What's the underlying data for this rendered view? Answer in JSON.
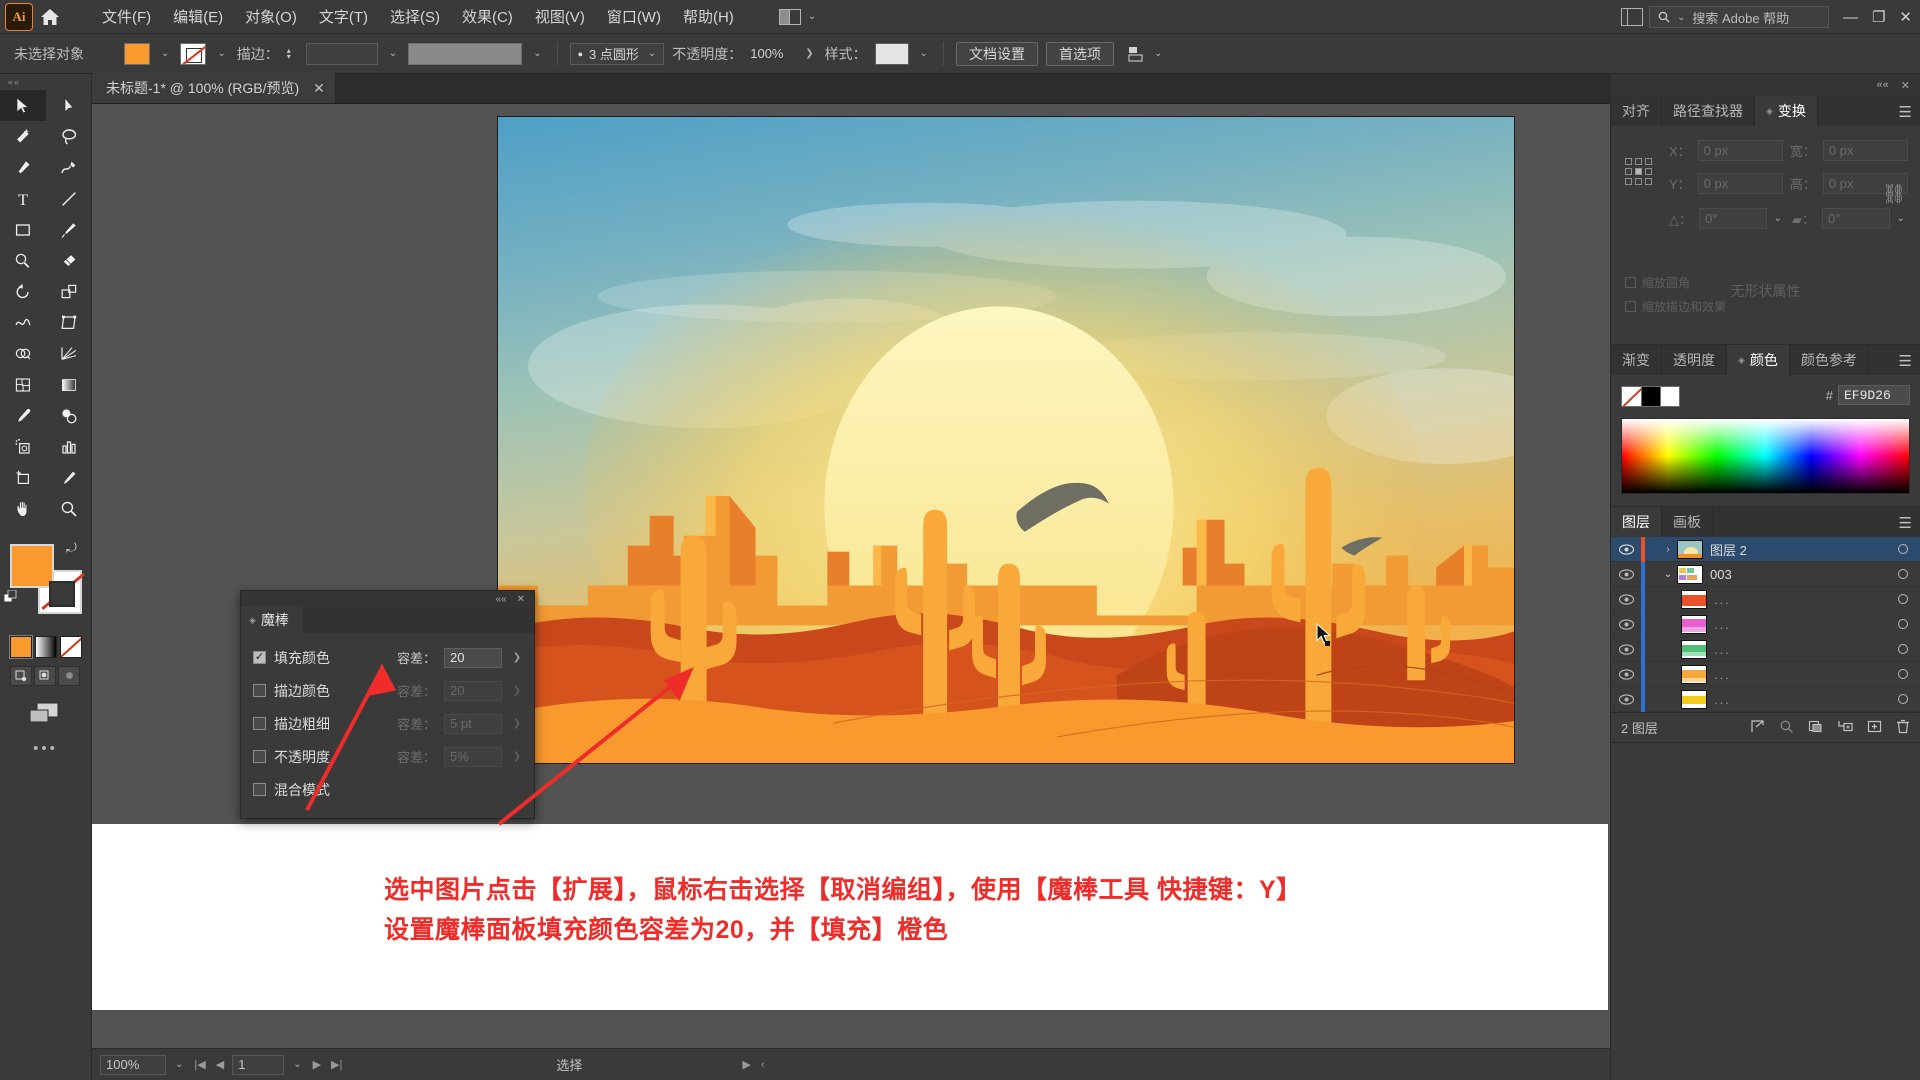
{
  "app": {
    "name": "Adobe Illustrator",
    "logo_text": "Ai"
  },
  "menubar": {
    "items": [
      {
        "label": "文件(F)"
      },
      {
        "label": "编辑(E)"
      },
      {
        "label": "对象(O)"
      },
      {
        "label": "文字(T)"
      },
      {
        "label": "选择(S)"
      },
      {
        "label": "效果(C)"
      },
      {
        "label": "视图(V)"
      },
      {
        "label": "窗口(W)"
      },
      {
        "label": "帮助(H)"
      }
    ],
    "search_placeholder": "搜索 Adobe 帮助",
    "minimize": "—",
    "restore": "❐",
    "close": "✕"
  },
  "controlbar": {
    "selection_status": "未选择对象",
    "fill_color": "#F89A2E",
    "stroke_label": "描边：",
    "stroke_weight": "",
    "stroke_profile": "",
    "brush_def": "3 点圆形",
    "opacity_label": "不透明度：",
    "opacity_value": "100%",
    "style_label": "样式：",
    "doc_setup_button": "文档设置",
    "preferences_button": "首选项",
    "align_label": ""
  },
  "document_tab": {
    "title": "未标题-1* @ 100% (RGB/预览)",
    "close": "✕"
  },
  "toolbar": {
    "tools": [
      {
        "name": "selection-tool",
        "selected": true
      },
      {
        "name": "direct-selection-tool",
        "selected": false
      },
      {
        "name": "magic-wand-tool",
        "selected": false
      },
      {
        "name": "lasso-tool",
        "selected": false
      },
      {
        "name": "pen-tool",
        "selected": false
      },
      {
        "name": "curvature-tool",
        "selected": false
      },
      {
        "name": "type-tool",
        "selected": false
      },
      {
        "name": "line-segment-tool",
        "selected": false
      },
      {
        "name": "rectangle-tool",
        "selected": false
      },
      {
        "name": "paintbrush-tool",
        "selected": false
      },
      {
        "name": "shaper-tool",
        "selected": false
      },
      {
        "name": "eraser-tool",
        "selected": false
      },
      {
        "name": "rotate-tool",
        "selected": false
      },
      {
        "name": "scale-tool",
        "selected": false
      },
      {
        "name": "width-tool",
        "selected": false
      },
      {
        "name": "free-transform-tool",
        "selected": false
      },
      {
        "name": "shape-builder-tool",
        "selected": false
      },
      {
        "name": "perspective-grid-tool",
        "selected": false
      },
      {
        "name": "mesh-tool",
        "selected": false
      },
      {
        "name": "gradient-tool",
        "selected": false
      },
      {
        "name": "eyedropper-tool",
        "selected": false
      },
      {
        "name": "blend-tool",
        "selected": false
      },
      {
        "name": "symbol-sprayer-tool",
        "selected": false
      },
      {
        "name": "column-graph-tool",
        "selected": false
      },
      {
        "name": "artboard-tool",
        "selected": false
      },
      {
        "name": "slice-tool",
        "selected": false
      },
      {
        "name": "hand-tool",
        "selected": false
      },
      {
        "name": "zoom-tool",
        "selected": false
      }
    ],
    "fill_color": "#F89A2E",
    "stroke_color": "none",
    "more_tools": "•••"
  },
  "magic_wand_panel": {
    "tab_label": "魔棒",
    "collapse": "««",
    "close": "✕",
    "rows": [
      {
        "label": "填充颜色",
        "checked": true,
        "tolerance_label": "容差：",
        "tolerance": "20",
        "enabled": true
      },
      {
        "label": "描边颜色",
        "checked": false,
        "tolerance_label": "容差：",
        "tolerance": "20",
        "enabled": false
      },
      {
        "label": "描边粗细",
        "checked": false,
        "tolerance_label": "容差：",
        "tolerance": "5 pt",
        "enabled": false
      },
      {
        "label": "不透明度",
        "checked": false,
        "tolerance_label": "容差：",
        "tolerance": "5%",
        "enabled": false
      },
      {
        "label": "混合模式",
        "checked": false,
        "tolerance_label": "",
        "tolerance": "",
        "enabled": false
      }
    ]
  },
  "caption": {
    "line1": "选中图片点击【扩展】，鼠标右击选择【取消编组】，使用【魔棒工具 快捷键：Y】",
    "line2": "设置魔棒面板填充颜色容差为20，并【填充】橙色",
    "color": "#EE2D2A"
  },
  "statusbar": {
    "zoom": "100%",
    "page": "1",
    "status_text": "选择",
    "first": "|◀",
    "prev": "◀",
    "next": "▶",
    "last": "▶|"
  },
  "right_panels": {
    "transform": {
      "tabs": [
        {
          "label": "对齐",
          "active": false
        },
        {
          "label": "路径查找器",
          "active": false
        },
        {
          "label": "变换",
          "active": true
        }
      ],
      "x_label": "X：",
      "x_value": "0 px",
      "y_label": "Y：",
      "y_value": "0 px",
      "w_label": "宽：",
      "w_value": "0 px",
      "h_label": "高：",
      "h_value": "0 px",
      "angle_label": "△：",
      "angle_value": "0°",
      "shear_label": "▰：",
      "shear_value": "0°",
      "empty_text": "无形状属性",
      "check1": "缩放圆角",
      "check2": "缩放描边和效果",
      "menu": "☰"
    },
    "color": {
      "tabs": [
        {
          "label": "渐变",
          "active": false
        },
        {
          "label": "透明度",
          "active": false
        },
        {
          "label": "颜色",
          "active": true
        },
        {
          "label": "颜色参考",
          "active": false
        }
      ],
      "hex_hash": "#",
      "hex_value": "EF9D26",
      "menu": "☰"
    },
    "layers": {
      "tabs": [
        {
          "label": "图层",
          "active": true
        },
        {
          "label": "画板",
          "active": false
        }
      ],
      "menu": "☰",
      "rows": [
        {
          "name": "图层 2",
          "selected": true,
          "indent": 0,
          "thumb": "art",
          "expander": "›",
          "bar_color": "#E8512A"
        },
        {
          "name": "003",
          "selected": false,
          "indent": 1,
          "thumb": "group",
          "expander": "⌄",
          "bar_color": "#2E6FD0"
        },
        {
          "name": "...",
          "selected": false,
          "indent": 2,
          "thumb": "#E8512A",
          "expander": "",
          "bar_color": "#2E6FD0"
        },
        {
          "name": "...",
          "selected": false,
          "indent": 2,
          "thumb": "#E55FD0",
          "expander": "",
          "bar_color": "#2E6FD0"
        },
        {
          "name": "...",
          "selected": false,
          "indent": 2,
          "thumb": "#4FBE7B",
          "expander": "",
          "bar_color": "#2E6FD0"
        },
        {
          "name": "...",
          "selected": false,
          "indent": 2,
          "thumb": "#F5A63C",
          "expander": "",
          "bar_color": "#2E6FD0"
        },
        {
          "name": "...",
          "selected": false,
          "indent": 2,
          "thumb": "#F3CB1B",
          "expander": "",
          "bar_color": "#2E6FD0"
        }
      ],
      "footer_count": "2 图层",
      "footer_icons": [
        "locate-object-icon",
        "search-icon",
        "make-clipping-mask-icon",
        "create-sublayer-icon",
        "create-new-layer-icon",
        "delete-layer-icon"
      ]
    }
  },
  "artwork": {
    "title": "desert-sunset-illustration",
    "sky_top": "#5BA8CB",
    "sky_mid": "#9CC4BC",
    "sky_glow": "#E8C35C",
    "sun": "#FAEFA8",
    "sand_front": "#F89A2E",
    "dune_mid": "#E8762A",
    "dune_dark": "#C9441A",
    "mesa": "#F08A2A",
    "cactus": "#F9A93A",
    "bird": "#6E6E63"
  }
}
